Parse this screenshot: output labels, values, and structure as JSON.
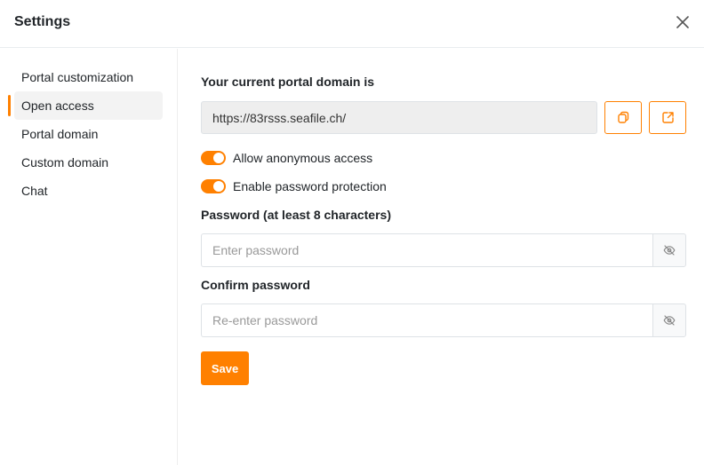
{
  "dialog": {
    "title": "Settings"
  },
  "sidebar": {
    "items": [
      {
        "label": "Portal customization",
        "active": false
      },
      {
        "label": "Open access",
        "active": true
      },
      {
        "label": "Portal domain",
        "active": false
      },
      {
        "label": "Custom domain",
        "active": false
      },
      {
        "label": "Chat",
        "active": false
      }
    ]
  },
  "main": {
    "domain_label": "Your current portal domain is",
    "domain_value": "https://83rsss.seafile.ch/",
    "copy_icon": "copy-icon",
    "open_icon": "external-link-icon",
    "toggles": [
      {
        "label": "Allow anonymous access",
        "on": true
      },
      {
        "label": "Enable password protection",
        "on": true
      }
    ],
    "password_label": "Password (at least 8 characters)",
    "password_placeholder": "Enter password",
    "confirm_label": "Confirm password",
    "confirm_placeholder": "Re-enter password",
    "eye_icon": "eye-off-icon",
    "save_label": "Save"
  },
  "colors": {
    "accent": "#ff8000",
    "nav_active_bg": "#f3f3f3",
    "field_bg": "#eeeeee"
  }
}
